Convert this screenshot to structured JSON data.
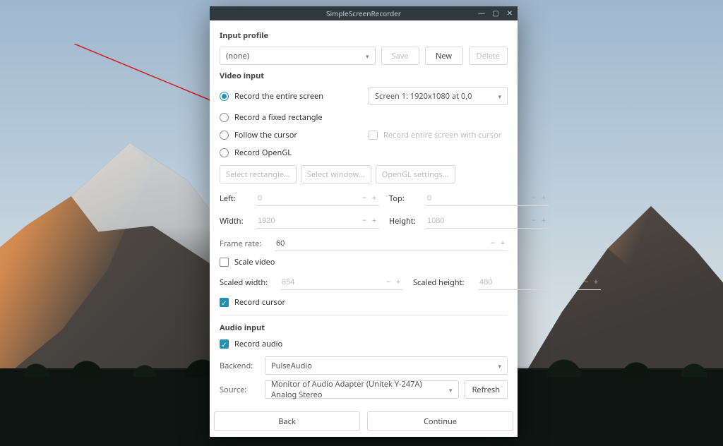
{
  "window": {
    "title": "SimpleScreenRecorder"
  },
  "profile": {
    "section_title": "Input profile",
    "selected": "(none)",
    "save_label": "Save",
    "new_label": "New",
    "delete_label": "Delete"
  },
  "video": {
    "section_title": "Video input",
    "options": {
      "entire_screen": "Record the entire screen",
      "fixed_rect": "Record a fixed rectangle",
      "follow_cursor": "Follow the cursor",
      "opengl": "Record OpenGL"
    },
    "screen_selected": "Screen 1: 1920x1080 at 0,0",
    "record_entire_with_cursor": "Record entire screen with cursor",
    "buttons": {
      "select_rectangle": "Select rectangle...",
      "select_window": "Select window...",
      "opengl_settings": "OpenGL settings..."
    },
    "left_label": "Left:",
    "left_value": "0",
    "top_label": "Top:",
    "top_value": "0",
    "width_label": "Width:",
    "width_value": "1920",
    "height_label": "Height:",
    "height_value": "1080",
    "frame_rate_label": "Frame rate:",
    "frame_rate_value": "60",
    "scale_video_label": "Scale video",
    "scaled_width_label": "Scaled width:",
    "scaled_width_value": "854",
    "scaled_height_label": "Scaled height:",
    "scaled_height_value": "480",
    "record_cursor_label": "Record cursor"
  },
  "audio": {
    "section_title": "Audio input",
    "record_audio_label": "Record audio",
    "backend_label": "Backend:",
    "backend_value": "PulseAudio",
    "source_label": "Source:",
    "source_value": "Monitor of Audio Adapter (Unitek Y-247A) Analog Stereo",
    "refresh_label": "Refresh"
  },
  "footer": {
    "back_label": "Back",
    "continue_label": "Continue"
  },
  "colors": {
    "accent": "#1f8fb6",
    "titlebar": "#2f3a3f",
    "arrow": "#d02424"
  }
}
